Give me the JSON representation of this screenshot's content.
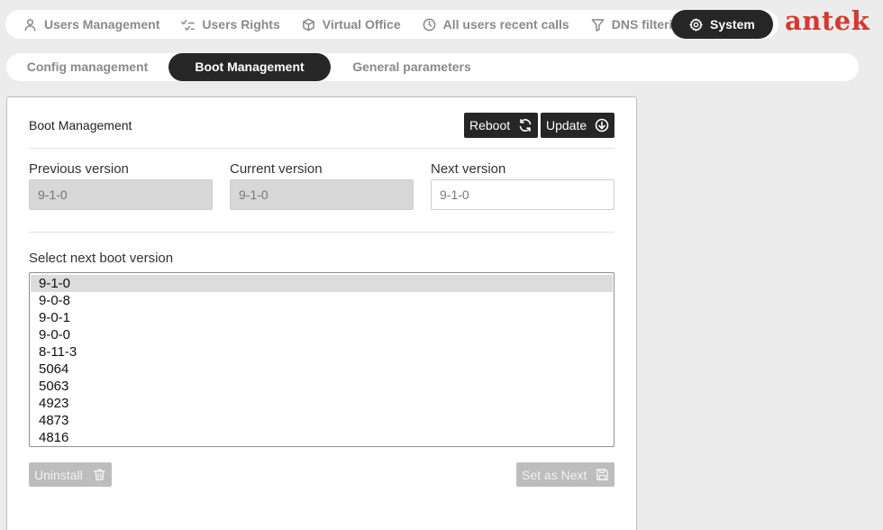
{
  "topnav": {
    "items": [
      {
        "label": "Users Management",
        "icon": "user-icon"
      },
      {
        "label": "Users Rights",
        "icon": "checks-icon"
      },
      {
        "label": "Virtual Office",
        "icon": "cube-icon"
      },
      {
        "label": "All users recent calls",
        "icon": "clock-icon"
      },
      {
        "label": "DNS filtering",
        "icon": "filter-icon"
      },
      {
        "label": "System",
        "icon": "gear-icon"
      }
    ],
    "active": "System"
  },
  "logo": "antek",
  "subnav": {
    "tabs": [
      "Config management",
      "Boot Management",
      "General parameters"
    ],
    "active": "Boot Management"
  },
  "panel": {
    "title": "Boot Management",
    "reboot_label": "Reboot",
    "update_label": "Update",
    "previous_version_label": "Previous version",
    "previous_version_value": "9-1-0",
    "current_version_label": "Current version",
    "current_version_value": "9-1-0",
    "next_version_label": "Next version",
    "next_version_value": "9-1-0",
    "select_label": "Select next boot version",
    "versions": [
      "9-1-0",
      "9-0-8",
      "9-0-1",
      "9-0-0",
      "8-11-3",
      "5064",
      "5063",
      "4923",
      "4873",
      "4816"
    ],
    "selected_version": "9-1-0",
    "uninstall_label": "Uninstall",
    "set_next_label": "Set as Next"
  },
  "colors": {
    "accent_dark": "#262626",
    "logo_red": "#d23a2f",
    "disabled_button": "#bdbdbd"
  }
}
